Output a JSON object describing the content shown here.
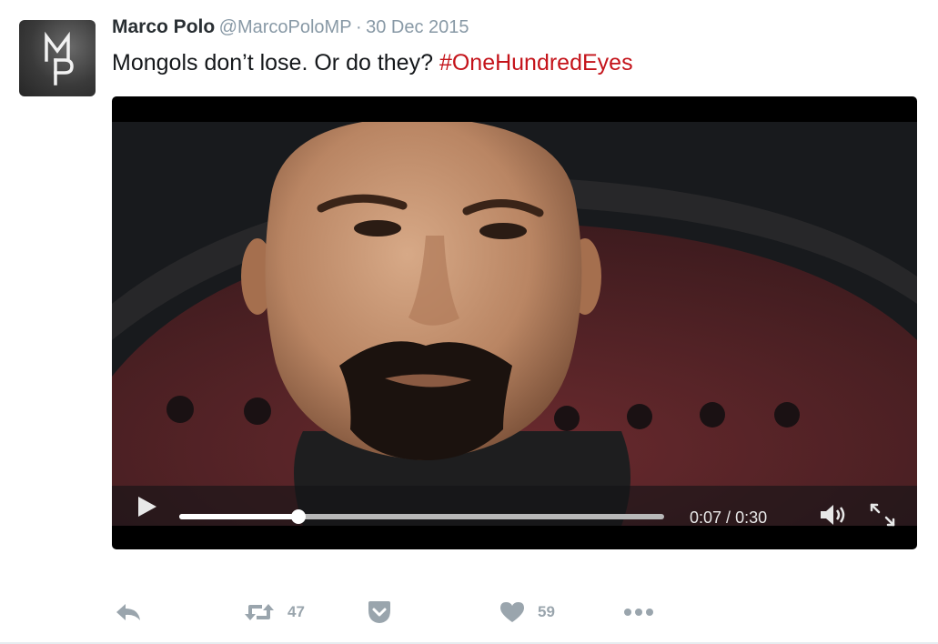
{
  "tweet": {
    "author": {
      "name": "Marco Polo",
      "handle": "@MarcoPoloMP",
      "avatar_text": "MP"
    },
    "separator": "·",
    "date": "30 Dec 2015",
    "text": "Mongols don’t lose. Or do they?",
    "hashtag": "#OneHundredEyes"
  },
  "video": {
    "current_time": "0:07",
    "duration": "0:30",
    "time_separator": " / ",
    "progress_fraction": 0.245
  },
  "actions": {
    "retweet_count": "47",
    "like_count": "59"
  },
  "colors": {
    "hashtag": "#c4131a",
    "muted_text": "#8899a6",
    "action_icon": "#9aa5ad"
  }
}
